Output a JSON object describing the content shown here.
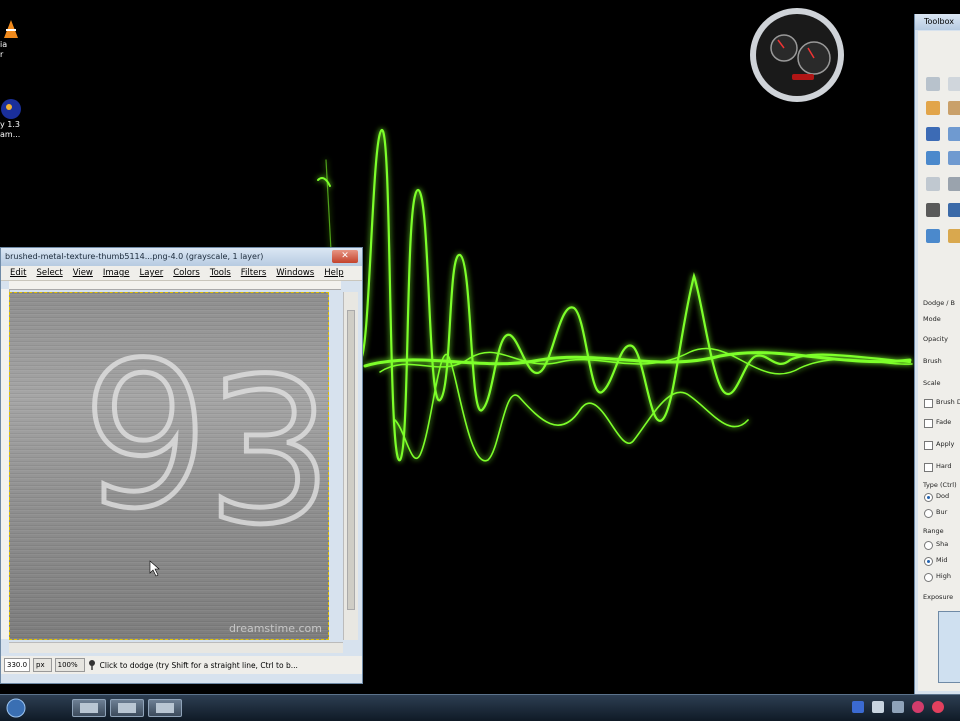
{
  "desktop": {
    "icons": [
      {
        "label": "ia\nr"
      },
      {
        "label": "y 1.3\nam..."
      }
    ]
  },
  "image_window": {
    "title": "brushed-metal-texture-thumb5114...png-4.0 (grayscale, 1 layer)",
    "close_glyph": "✕",
    "menu": [
      "Edit",
      "Select",
      "View",
      "Image",
      "Layer",
      "Colors",
      "Tools",
      "Filters",
      "Windows",
      "Help"
    ],
    "canvas_text": [
      "9",
      "3"
    ],
    "watermark": "dreamstime.com",
    "status": {
      "coords": "330.0",
      "unit": "px",
      "zoom": "100%",
      "message": "Click to dodge (try Shift for a straight line, Ctrl to b..."
    }
  },
  "toolbox": {
    "title": "Toolbox",
    "labels": {
      "tool_name": "Dodge / B",
      "mode": "Mode",
      "opacity": "Opacity",
      "brush": "Brush",
      "scale": "Scale",
      "brush_dyn": "Brush D",
      "fade": "Fade",
      "apply": "Apply",
      "hard": "Hard",
      "type": "Type (Ctrl)",
      "type_opt1": "Dod",
      "type_opt2": "Bur",
      "range": "Range",
      "range_opt1": "Sha",
      "range_opt2": "Mid",
      "range_opt3": "High",
      "exposure": "Exposure"
    }
  },
  "colors": {
    "wave": "#7dff2a",
    "window_frame": "#6f8aa6",
    "taskbar": "#1b2a3a"
  }
}
